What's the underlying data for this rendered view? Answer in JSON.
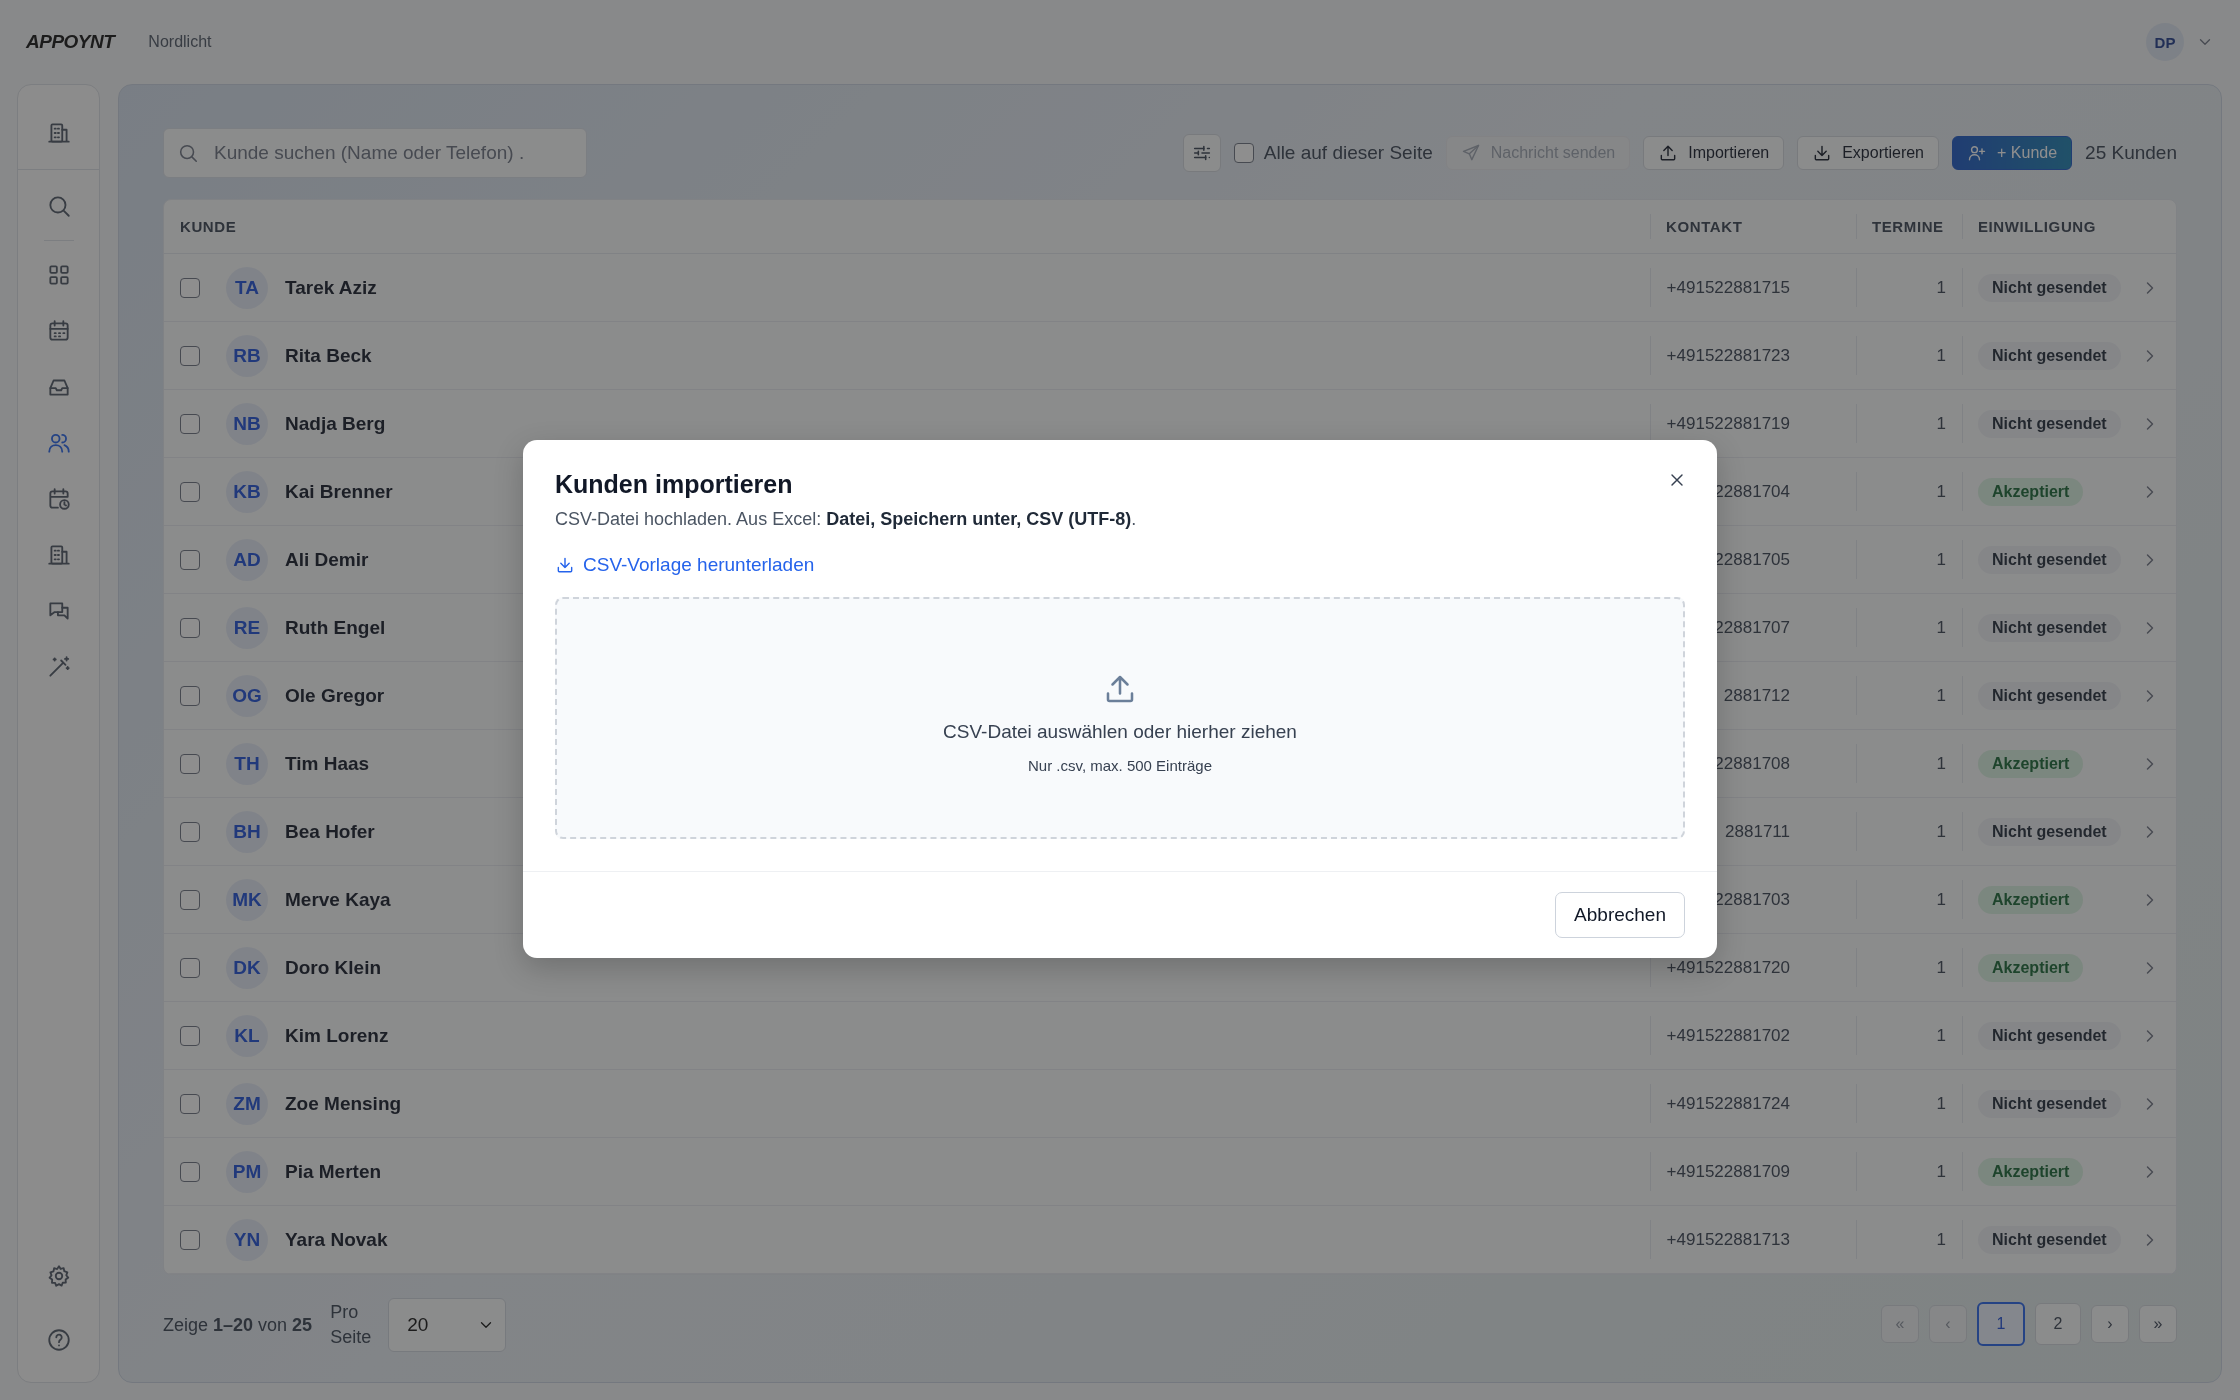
{
  "topbar": {
    "logo": "APPOYNT",
    "workspace": "Nordlicht",
    "user_initials": "DP"
  },
  "sidebar": {
    "header_items": [
      {
        "selected": false
      }
    ],
    "search_items": [
      {
        "selected": false
      }
    ],
    "items": [
      {
        "selected": false
      },
      {
        "selected": false
      },
      {
        "selected": false
      },
      {
        "selected": true
      },
      {
        "selected": false
      },
      {
        "selected": false
      },
      {
        "selected": false
      },
      {
        "selected": false
      }
    ],
    "footer_items": [
      {
        "selected": false
      },
      {
        "selected": false
      }
    ]
  },
  "toolbar": {
    "search": {
      "placeholder": "Kunde suchen (Name oder Telefon) ."
    },
    "select_all": {
      "label": "Alle auf dieser Seite",
      "checked": false
    },
    "buttons": [
      {
        "kind": "send",
        "label": "Nachricht senden",
        "disabled": true
      },
      {
        "kind": "import",
        "label": "Importieren",
        "disabled": false
      },
      {
        "kind": "export",
        "label": "Exportieren",
        "disabled": false
      },
      {
        "kind": "add",
        "label": "+ Kunde",
        "disabled": false
      }
    ],
    "count": "25 Kunden"
  },
  "table": {
    "columns": [
      "KUNDE",
      "KONTAKT",
      "TERMINE",
      "EINWILLIGUNG"
    ],
    "rows": [
      {
        "checked": false,
        "initials": "TA",
        "name": "Tarek Aziz",
        "contact": "+491522881715",
        "appointments": "1",
        "consent": {
          "kind": "pending",
          "label": "Nicht gesendet"
        }
      },
      {
        "checked": false,
        "initials": "RB",
        "name": "Rita Beck",
        "contact": "+491522881723",
        "appointments": "1",
        "consent": {
          "kind": "pending",
          "label": "Nicht gesendet"
        }
      },
      {
        "checked": false,
        "initials": "NB",
        "name": "Nadja Berg",
        "contact": "+491522881719",
        "appointments": "1",
        "consent": {
          "kind": "pending",
          "label": "Nicht gesendet"
        }
      },
      {
        "checked": false,
        "initials": "KB",
        "name": "Kai Brenner",
        "contact": "22881704",
        "appointments": "1",
        "consent": {
          "kind": "accepted",
          "label": "Akzeptiert"
        }
      },
      {
        "checked": false,
        "initials": "AD",
        "name": "Ali Demir",
        "contact": "22881705",
        "appointments": "1",
        "consent": {
          "kind": "pending",
          "label": "Nicht gesendet"
        }
      },
      {
        "checked": false,
        "initials": "RE",
        "name": "Ruth Engel",
        "contact": "22881707",
        "appointments": "1",
        "consent": {
          "kind": "pending",
          "label": "Nicht gesendet"
        }
      },
      {
        "checked": false,
        "initials": "OG",
        "name": "Ole Gregor",
        "contact": "2881712",
        "appointments": "1",
        "consent": {
          "kind": "pending",
          "label": "Nicht gesendet"
        }
      },
      {
        "checked": false,
        "initials": "TH",
        "name": "Tim Haas",
        "contact": "22881708",
        "appointments": "1",
        "consent": {
          "kind": "accepted",
          "label": "Akzeptiert"
        }
      },
      {
        "checked": false,
        "initials": "BH",
        "name": "Bea Hofer",
        "contact": "2881711",
        "appointments": "1",
        "consent": {
          "kind": "pending",
          "label": "Nicht gesendet"
        }
      },
      {
        "checked": false,
        "initials": "MK",
        "name": "Merve Kaya",
        "contact": "22881703",
        "appointments": "1",
        "consent": {
          "kind": "accepted",
          "label": "Akzeptiert"
        }
      },
      {
        "checked": false,
        "initials": "DK",
        "name": "Doro Klein",
        "contact": "+491522881720",
        "appointments": "1",
        "consent": {
          "kind": "accepted",
          "label": "Akzeptiert"
        }
      },
      {
        "checked": false,
        "initials": "KL",
        "name": "Kim Lorenz",
        "contact": "+491522881702",
        "appointments": "1",
        "consent": {
          "kind": "pending",
          "label": "Nicht gesendet"
        }
      },
      {
        "checked": false,
        "initials": "ZM",
        "name": "Zoe Mensing",
        "contact": "+491522881724",
        "appointments": "1",
        "consent": {
          "kind": "pending",
          "label": "Nicht gesendet"
        }
      },
      {
        "checked": false,
        "initials": "PM",
        "name": "Pia Merten",
        "contact": "+491522881709",
        "appointments": "1",
        "consent": {
          "kind": "accepted",
          "label": "Akzeptiert"
        }
      },
      {
        "checked": false,
        "initials": "YN",
        "name": "Yara Novak",
        "contact": "+491522881713",
        "appointments": "1",
        "consent": {
          "kind": "pending",
          "label": "Nicht gesendet"
        }
      }
    ]
  },
  "footer": {
    "range": "Zeige **1–20** von **25**",
    "per_page_label": "Pro Seite",
    "per_page": "20",
    "pages": [
      {
        "label": "«",
        "selected": false,
        "disabled": true
      },
      {
        "label": "‹",
        "selected": false,
        "disabled": true
      },
      {
        "label": "1",
        "selected": true,
        "disabled": false
      },
      {
        "label": "2",
        "selected": false,
        "disabled": false
      },
      {
        "label": "›",
        "selected": false,
        "disabled": false
      },
      {
        "label": "»",
        "selected": false,
        "disabled": false
      }
    ]
  },
  "dialog": {
    "title": "Kunden importieren",
    "description": "CSV-Datei hochladen. Aus Excel: **Datei, Speichern unter, CSV (UTF-8)**.",
    "template_link": "CSV-Vorlage herunterladen",
    "dropzone": {
      "text": "CSV-Datei auswählen oder hierher ziehen",
      "hint": "Nur .csv, max. 500 Einträge"
    },
    "cancel": "Abbrechen"
  }
}
